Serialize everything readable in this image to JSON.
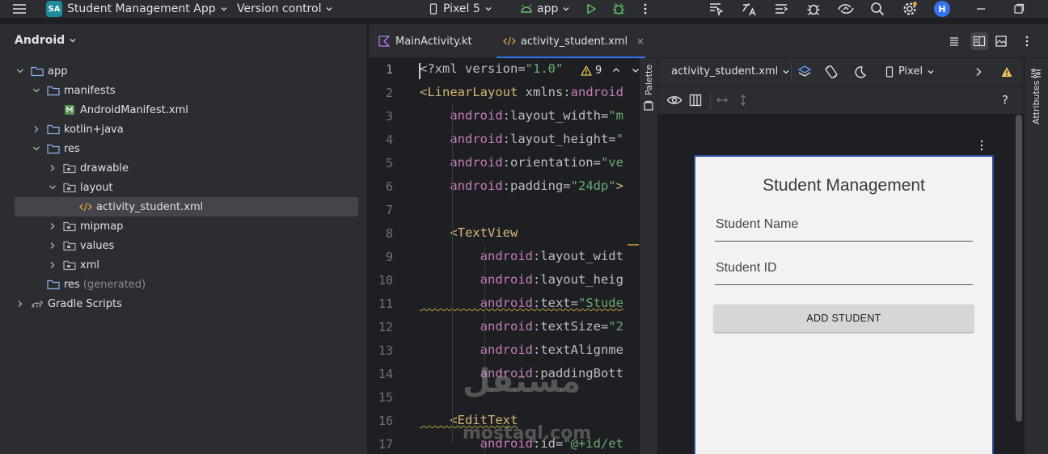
{
  "titlebar": {
    "project_badge": "SA",
    "project_name": "Student Management App",
    "vcs": "Version control",
    "device": "Pixel 5",
    "run_config": "app",
    "avatar_letter": "H",
    "icons": [
      "main-menu-icon",
      "run-icon",
      "debug-icon",
      "more-icon",
      "cursor-icon",
      "translate-icon",
      "commit-icon",
      "bug-icon",
      "device-sync-icon",
      "search-icon",
      "settings-icon",
      "minimize-icon",
      "restore-icon"
    ]
  },
  "project": {
    "view_label": "Android",
    "tree": [
      {
        "label": "app",
        "type": "app",
        "level": 0,
        "expanded": true
      },
      {
        "label": "manifests",
        "type": "folder",
        "level": 1,
        "expanded": true
      },
      {
        "label": "AndroidManifest.xml",
        "type": "manifest",
        "level": 2
      },
      {
        "label": "kotlin+java",
        "type": "folder",
        "level": 1,
        "expanded": false
      },
      {
        "label": "res",
        "type": "folder",
        "level": 1,
        "expanded": true
      },
      {
        "label": "drawable",
        "type": "resfolder",
        "level": 2,
        "expanded": false
      },
      {
        "label": "layout",
        "type": "resfolder",
        "level": 2,
        "expanded": true
      },
      {
        "label": "activity_student.xml",
        "type": "xml",
        "level": 3,
        "selected": true
      },
      {
        "label": "mipmap",
        "type": "resfolder",
        "level": 2,
        "expanded": false
      },
      {
        "label": "values",
        "type": "resfolder",
        "level": 2,
        "expanded": false
      },
      {
        "label": "xml",
        "type": "resfolder",
        "level": 2,
        "expanded": false
      },
      {
        "label": "res",
        "suffix": "(generated)",
        "type": "folder",
        "level": 1
      },
      {
        "label": "Gradle Scripts",
        "type": "gradle",
        "level": 0,
        "expanded": false
      }
    ]
  },
  "editor": {
    "tabs": [
      {
        "label": "MainActivity.kt",
        "active": false
      },
      {
        "label": "activity_student.xml",
        "active": true
      }
    ],
    "warning_count": "9",
    "line_numbers": [
      "1",
      "2",
      "3",
      "4",
      "5",
      "6",
      "7",
      "8",
      "9",
      "10",
      "11",
      "12",
      "13",
      "14",
      "15",
      "16",
      "17"
    ],
    "code_lines": [
      [
        {
          "t": "<?xml version=",
          "c": ""
        },
        {
          "t": "\"1.0\"",
          "c": "st"
        }
      ],
      [
        {
          "t": "<LinearLayout ",
          "c": "tg"
        },
        {
          "t": "xmlns:",
          "c": ""
        },
        {
          "t": "android",
          "c": "at"
        }
      ],
      [
        {
          "t": "    android",
          "c": "at"
        },
        {
          "t": ":layout_width=",
          "c": ""
        },
        {
          "t": "\"m",
          "c": "st"
        }
      ],
      [
        {
          "t": "    android",
          "c": "at"
        },
        {
          "t": ":layout_height=",
          "c": ""
        },
        {
          "t": "\"",
          "c": "st"
        }
      ],
      [
        {
          "t": "    android",
          "c": "at"
        },
        {
          "t": ":orientation=",
          "c": ""
        },
        {
          "t": "\"ve",
          "c": "st"
        }
      ],
      [
        {
          "t": "    android",
          "c": "at"
        },
        {
          "t": ":padding=",
          "c": ""
        },
        {
          "t": "\"24dp\"",
          "c": "st"
        },
        {
          "t": ">",
          "c": "tg"
        }
      ],
      [],
      [
        {
          "t": "    <TextView",
          "c": "tg"
        }
      ],
      [
        {
          "t": "        android",
          "c": "at"
        },
        {
          "t": ":layout_widt",
          "c": ""
        }
      ],
      [
        {
          "t": "        android",
          "c": "at"
        },
        {
          "t": ":layout_heig",
          "c": ""
        }
      ],
      [
        {
          "t": "        android",
          "c": "at w"
        },
        {
          "t": ":text=",
          "c": "w"
        },
        {
          "t": "\"Stude",
          "c": "st w"
        }
      ],
      [
        {
          "t": "        android",
          "c": "at"
        },
        {
          "t": ":textSize=",
          "c": ""
        },
        {
          "t": "\"2",
          "c": "st"
        }
      ],
      [
        {
          "t": "        android",
          "c": "at"
        },
        {
          "t": ":textAlignme",
          "c": ""
        }
      ],
      [
        {
          "t": "        android",
          "c": "at"
        },
        {
          "t": ":paddingBott",
          "c": ""
        }
      ],
      [],
      [
        {
          "t": "    <EditText",
          "c": "tg w"
        }
      ],
      [
        {
          "t": "        android",
          "c": "at"
        },
        {
          "t": ":id=",
          "c": ""
        },
        {
          "t": "\"@+id/et",
          "c": "st"
        }
      ]
    ]
  },
  "palette": {
    "label": "Palette"
  },
  "design": {
    "file_label": "activity_student.xml",
    "device_label": "Pixel",
    "preview": {
      "title": "Student Management",
      "name_hint": "Student Name",
      "id_hint": "Student ID",
      "button": "ADD STUDENT"
    }
  },
  "attributes": {
    "label": "Attributes"
  },
  "watermark": {
    "arabic": "مستقل",
    "latin": "mostaql.com"
  },
  "colors": {
    "accent": "#3574f0",
    "tag": "#d5b778",
    "attr": "#c77dbb",
    "string": "#6aab73",
    "warning": "#f2c55c"
  }
}
